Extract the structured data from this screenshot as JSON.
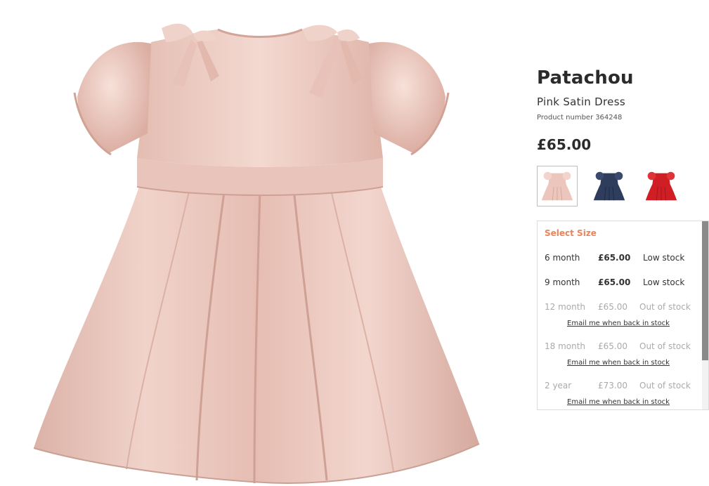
{
  "product": {
    "brand": "Patachou",
    "name": "Pink Satin Dress",
    "number_label": "Product number",
    "number": "364248",
    "price": "£65.00",
    "image_icon": "pink-satin-dress-photo"
  },
  "swatches": [
    {
      "color_name": "pink",
      "color": "#ecc6bd",
      "selected": true
    },
    {
      "color_name": "navy",
      "color": "#2f3d5c",
      "selected": false
    },
    {
      "color_name": "red",
      "color": "#cf1f25",
      "selected": false
    }
  ],
  "size_select": {
    "title": "Select Size",
    "notify_label": "Email me when back in stock",
    "options": [
      {
        "size": "6 month",
        "price": "£65.00",
        "stock": "Low stock"
      },
      {
        "size": "9 month",
        "price": "£65.00",
        "stock": "Low stock"
      },
      {
        "size": "12 month",
        "price": "£65.00",
        "stock": "Out of stock"
      },
      {
        "size": "18 month",
        "price": "£65.00",
        "stock": "Out of stock"
      },
      {
        "size": "2 year",
        "price": "£73.00",
        "stock": "Out of stock"
      }
    ]
  },
  "colors": {
    "accent": "#e8845e",
    "dress": "#ecc6bd",
    "dress_shadow": "#d9a89d",
    "text": "#2b2b2b",
    "muted": "#aaaaaa"
  }
}
